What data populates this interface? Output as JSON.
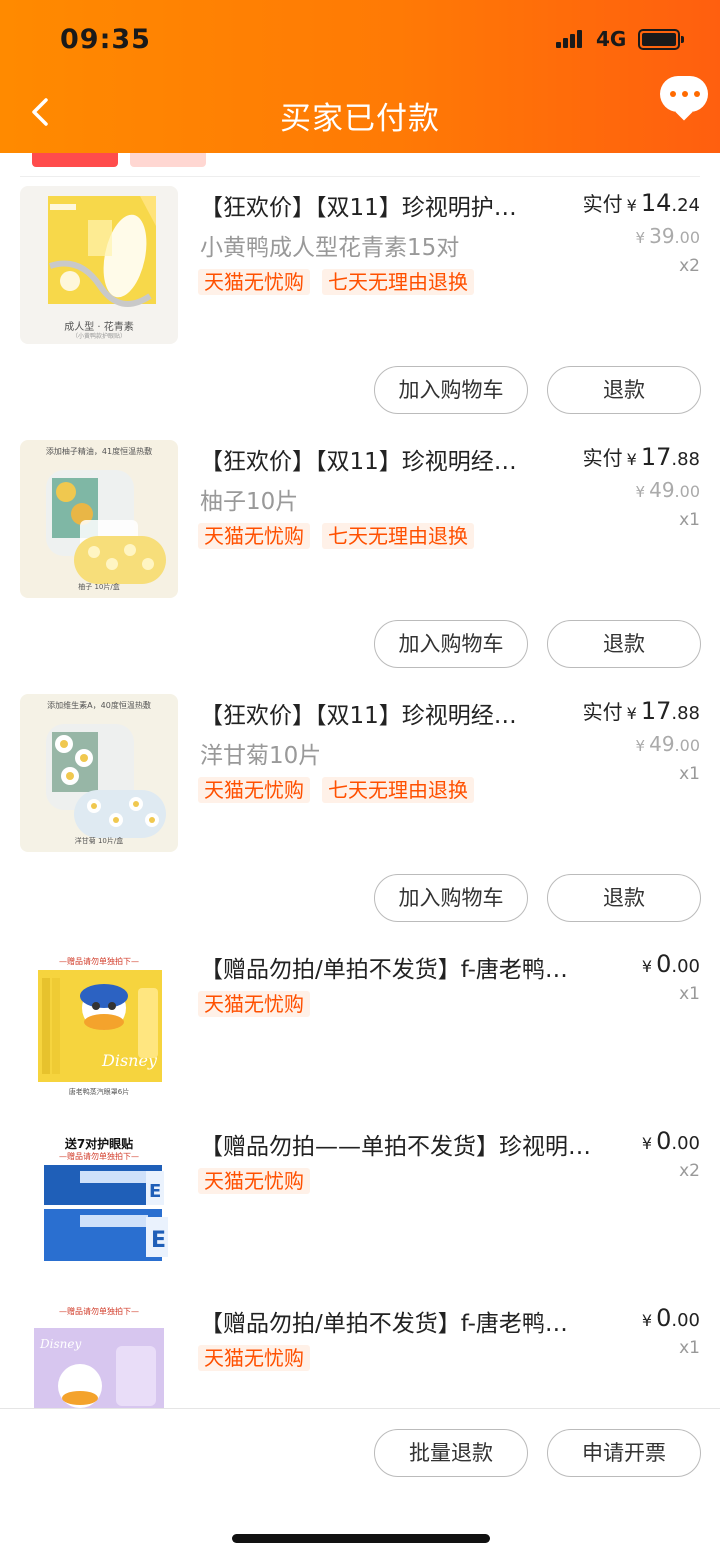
{
  "status_bar": {
    "time": "09:35",
    "network": "4G"
  },
  "header": {
    "title": "买家已付款"
  },
  "items": [
    {
      "title": "【狂欢价】【双11】珍视明护…",
      "spec": "小黄鸭成人型花青素15对",
      "tags": [
        "天猫无忧购",
        "七天无理由退换"
      ],
      "paid_label": "实付",
      "currency": "¥",
      "paid_int": "14",
      "paid_dec": ".24",
      "orig_int": "39",
      "orig_dec": ".00",
      "qty": "x2",
      "thumb_caption": "成人型 · 花青素",
      "thumb_sub": "（小黄鸭款护眼贴）",
      "btn_cart": "加入购物车",
      "btn_refund": "退款"
    },
    {
      "title": "【狂欢价】【双11】珍视明经…",
      "spec": "柚子10片",
      "tags": [
        "天猫无忧购",
        "七天无理由退换"
      ],
      "paid_label": "实付",
      "currency": "¥",
      "paid_int": "17",
      "paid_dec": ".88",
      "orig_int": "49",
      "orig_dec": ".00",
      "qty": "x1",
      "thumb_caption": "添加柚子精油，41度恒温热敷",
      "thumb_sub": "柚子 10片/盒",
      "btn_cart": "加入购物车",
      "btn_refund": "退款"
    },
    {
      "title": "【狂欢价】【双11】珍视明经…",
      "spec": "洋甘菊10片",
      "tags": [
        "天猫无忧购",
        "七天无理由退换"
      ],
      "paid_label": "实付",
      "currency": "¥",
      "paid_int": "17",
      "paid_dec": ".88",
      "orig_int": "49",
      "orig_dec": ".00",
      "qty": "x1",
      "thumb_caption": "添加维生素A，40度恒温热敷",
      "thumb_sub": "洋甘菊 10片/盒",
      "btn_cart": "加入购物车",
      "btn_refund": "退款"
    },
    {
      "title": "【赠品勿拍/单拍不发货】f-唐老鸭…",
      "tags": [
        "天猫无忧购"
      ],
      "currency": "¥",
      "price_int": "0",
      "price_dec": ".00",
      "qty": "x1",
      "thumb_caption": "—赠品请勿单独拍下—",
      "thumb_sub": "唐老鸭蒸汽眼罩6片"
    },
    {
      "title": "【赠品勿拍——单拍不发货】珍视明…",
      "tags": [
        "天猫无忧购"
      ],
      "currency": "¥",
      "price_int": "0",
      "price_dec": ".00",
      "qty": "x2",
      "thumb_caption": "送7对护眼贴",
      "thumb_sub": "—赠品请勿单独拍下—"
    },
    {
      "title": "【赠品勿拍/单拍不发货】f-唐老鸭…",
      "tags": [
        "天猫无忧购"
      ],
      "currency": "¥",
      "price_int": "0",
      "price_dec": ".00",
      "qty": "x1",
      "thumb_caption": "—赠品请勿单独拍下—"
    }
  ],
  "footer": {
    "batch_refund": "批量退款",
    "invoice": "申请开票"
  },
  "colors": {
    "header_start": "#ff8a00",
    "header_end": "#ff5f0f",
    "tag_text": "#ff5000",
    "tag_bg": "#fff1e8"
  }
}
